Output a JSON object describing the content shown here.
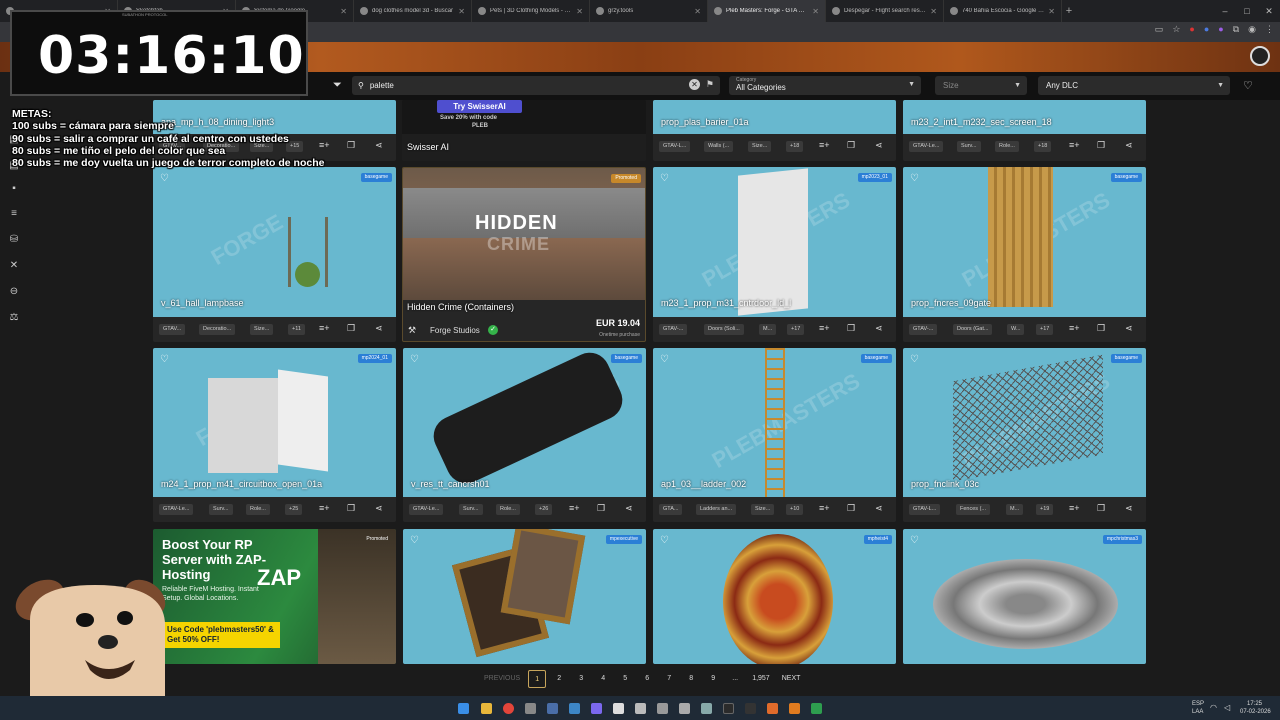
{
  "browser": {
    "tabs": [
      {
        "label": ""
      },
      {
        "label": "Sketchfab"
      },
      {
        "label": "Sistema de Google"
      },
      {
        "label": "dog clothes model 3d - Buscar"
      },
      {
        "label": "Pets | 3D Clothing Models - CG"
      },
      {
        "label": "grzy.tools"
      },
      {
        "label": "Pleb Masters: Forge - GTA V Ci"
      },
      {
        "label": "Despegar - Flight search results"
      },
      {
        "label": "740 Bahia Escocia - Google Ma"
      }
    ],
    "new_tab": "+",
    "win_controls": [
      "–",
      "□",
      "✕"
    ]
  },
  "filters": {
    "search_value": "palette",
    "category_label": "Category",
    "category_value": "All Categories",
    "size_placeholder": "Size",
    "dlc_value": "Any DLC"
  },
  "cards": {
    "r0c0": {
      "name": "apa_mp_h_08_dining_light3",
      "chips": [
        "GTAV...",
        "Decoratio...",
        "Size...",
        "+15"
      ]
    },
    "r0c1": {
      "top": "Try SwisserAI",
      "top2": "Save 20% with code",
      "top3": "PLEB",
      "name": "Swisser AI"
    },
    "r0c2": {
      "name": "prop_plas_barier_01a",
      "chips": [
        "GTAV-L...",
        "Walls (...",
        "Size...",
        "+18"
      ]
    },
    "r0c3": {
      "name": "m23_2_int1_m232_sec_screen_18",
      "chips": [
        "GTAV-Le...",
        "Surv...",
        "Role...",
        "+18"
      ]
    },
    "r1c0": {
      "name": "v_61_hall_lampbase",
      "badge": "basegame",
      "chips": [
        "GTAV...",
        "Decoratio...",
        "Size...",
        "+11"
      ]
    },
    "r1c1": {
      "badge": "Promoted",
      "img_title": "HIDDEN",
      "img_sub": "CRIME",
      "name": "Hidden Crime (Containers)",
      "publisher": "Forge Studios",
      "price": "EUR 19.04",
      "price_note": "Onetime purchase"
    },
    "r1c2": {
      "name": "m23_1_prop_m31_cntrdoor_ld_l",
      "badge": "mp2023_01",
      "chips": [
        "GTAV-...",
        "Doors (Soli...",
        "M...",
        "+17"
      ]
    },
    "r1c3": {
      "name": "prop_fncres_09gate",
      "badge": "basegame",
      "chips": [
        "GTAV-...",
        "Doors (Gat...",
        "W...",
        "+17"
      ]
    },
    "r2c0": {
      "name": "m24_1_prop_m41_circuitbox_open_01a",
      "badge": "mp2024_01",
      "chips": [
        "GTAV-Le...",
        "Surv...",
        "Role...",
        "+25"
      ]
    },
    "r2c1": {
      "name": "v_res_tt_cancrsh01",
      "badge": "basegame",
      "chips": [
        "GTAV-Le...",
        "Surv...",
        "Role...",
        "+26"
      ]
    },
    "r2c2": {
      "name": "ap1_03__ladder_002",
      "badge": "basegame",
      "chips": [
        "GTA...",
        "Ladders an...",
        "Size...",
        "+10"
      ]
    },
    "r2c3": {
      "name": "prop_fnclink_03c",
      "badge": "basegame",
      "chips": [
        "GTAV-L...",
        "Fences (...",
        "M...",
        "+19"
      ]
    },
    "r3c1": {
      "badge": "mpexecutive"
    },
    "r3c2": {
      "badge": "mpheist4"
    },
    "r3c3": {
      "badge": "mpchristmas3"
    }
  },
  "ad": {
    "badge": "Promoted",
    "headline": "Boost Your RP Server with ZAP-Hosting",
    "body": "Reliable FiveM Hosting. Instant Setup. Global Locations.",
    "logo": "ZAP",
    "code": "Use Code 'plebmasters50' & Get 50% OFF!"
  },
  "pagination": {
    "previous": "PREVIOUS",
    "pages": [
      "1",
      "2",
      "3",
      "4",
      "5",
      "6",
      "7",
      "8",
      "9",
      "...",
      "1,957"
    ],
    "next": "NEXT"
  },
  "overlay": {
    "timer": "03:16:10",
    "timer_tag": "SUBATHON PROTOCOL",
    "metas": [
      "METAS:",
      "100 subs = cámara para siempre",
      "90 subs = salir a comprar un café al centro con ustedes",
      "80 subs = me tiño el pelo del color que sea",
      "80 subs = me doy vuelta un juego de terror completo de noche"
    ]
  },
  "taskbar": {
    "lang": "ESP",
    "lang2": "LAA",
    "time": "17:25",
    "date": "07-02-2026"
  },
  "colors": {
    "card_bg": "#68b8cf",
    "badge_blue": "#2b7fd6",
    "badge_promo": "#c7882a",
    "page_active": "#c7a55c"
  }
}
